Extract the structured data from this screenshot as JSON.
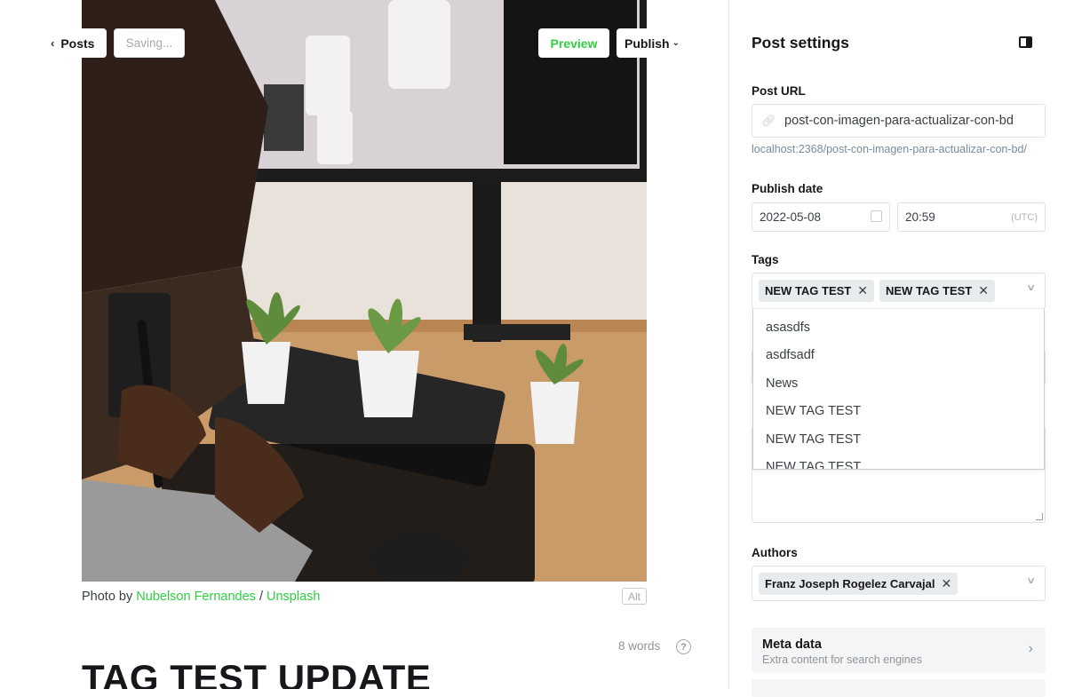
{
  "topbar": {
    "back_label": "Posts",
    "saving_label": "Saving...",
    "preview_label": "Preview",
    "publish_label": "Publish"
  },
  "image": {
    "caption_prefix": "Photo by",
    "caption_author": "Nubelson Fernandes",
    "caption_separator": "/",
    "caption_source": "Unsplash",
    "alt_label": "Alt"
  },
  "editor": {
    "word_count": "8 words",
    "help": "?",
    "title": "TAG TEST UPDATE"
  },
  "sidebar": {
    "title": "Post settings",
    "post_url": {
      "label": "Post URL",
      "value": "post-con-imagen-para-actualizar-con-bd",
      "hint": "localhost:2368/post-con-imagen-para-actualizar-con-bd/"
    },
    "publish_date": {
      "label": "Publish date",
      "date": "2022-05-08",
      "time": "20:59",
      "timezone": "(UTC)"
    },
    "tags": {
      "label": "Tags",
      "selected": [
        "NEW TAG TEST",
        "NEW TAG TEST"
      ],
      "options": [
        "asasdfs",
        "asdfsadf",
        "News",
        "NEW TAG TEST",
        "NEW TAG TEST",
        "NEW TAG TEST"
      ]
    },
    "authors": {
      "label": "Authors",
      "selected": [
        "Franz Joseph Rogelez Carvajal"
      ]
    },
    "meta_data": {
      "title": "Meta data",
      "subtitle": "Extra content for search engines"
    }
  },
  "colors": {
    "accent_green": "#30cf43",
    "chip_bg": "#e8ebee"
  }
}
